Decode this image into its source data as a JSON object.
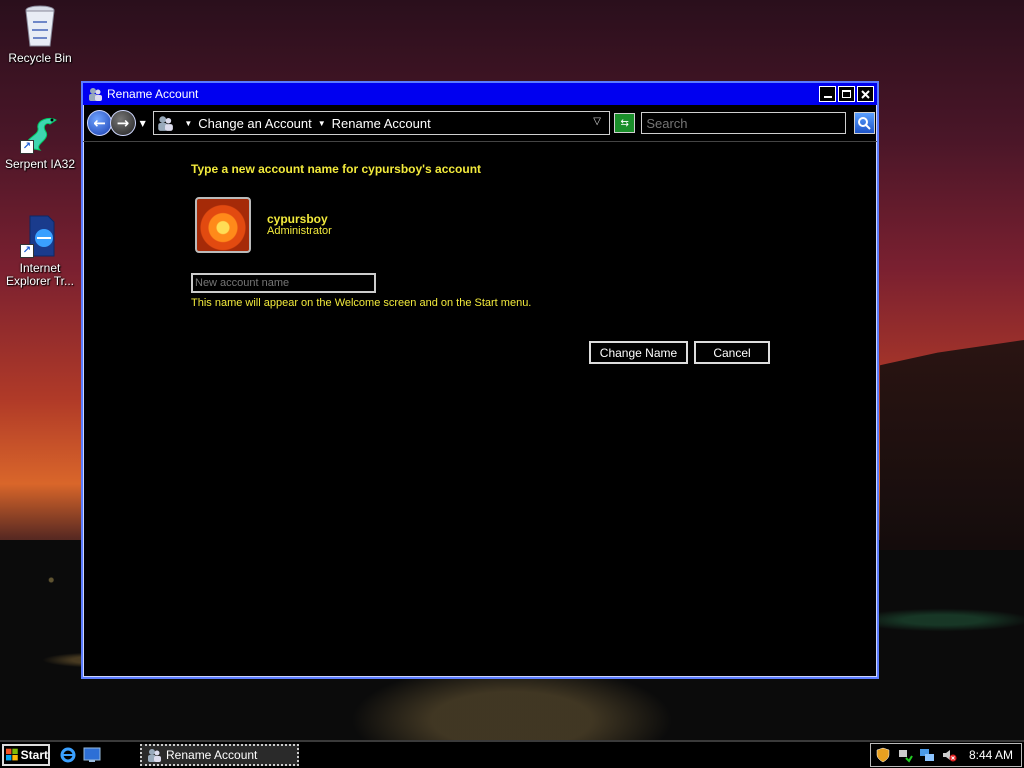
{
  "desktop": {
    "icons": [
      {
        "label": "Recycle Bin",
        "icon": "recycle-bin-icon"
      },
      {
        "label": "Serpent IA32",
        "icon": "serpent-dragon-icon"
      },
      {
        "label": "Internet Explorer Tr...",
        "icon": "internet-explorer-icon"
      }
    ]
  },
  "window": {
    "title": "Rename Account",
    "controls": {
      "minimize": "minimize",
      "maximize": "maximize",
      "close": "close"
    },
    "breadcrumb": [
      "Change an Account",
      "Rename Account"
    ],
    "search_placeholder": "Search",
    "heading": "Type a new account name for cypursboy's account",
    "account": {
      "name": "cypursboy",
      "role": "Administrator"
    },
    "input_placeholder": "New account name",
    "hint": "This name will appear on the Welcome screen and on the Start menu.",
    "buttons": {
      "change": "Change Name",
      "cancel": "Cancel"
    }
  },
  "taskbar": {
    "start_label": "Start",
    "quick_launch": [
      "internet-explorer-icon",
      "show-desktop-icon"
    ],
    "task_button": "Rename Account",
    "tray_icons": [
      "security-shield-icon",
      "network-icon",
      "network-connections-icon",
      "volume-muted-icon"
    ],
    "clock": "8:44 AM"
  },
  "colors": {
    "titlebar": "#0000f0",
    "text_yellow": "#f2ea3c",
    "text_green": "#2ee83a",
    "window_bg": "#000000"
  }
}
